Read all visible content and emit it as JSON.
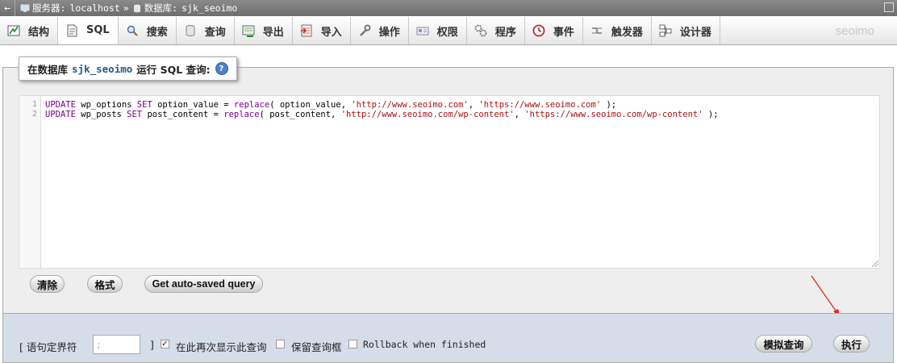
{
  "breadcrumb": {
    "back": "←",
    "server_label": "服务器:",
    "server_value": "localhost",
    "separator": "»",
    "db_label": "数据库:",
    "db_value": "sjk_seoimo"
  },
  "tabs": [
    {
      "label": "结构",
      "icon": "structure-icon"
    },
    {
      "label": "SQL",
      "icon": "sql-icon"
    },
    {
      "label": "搜索",
      "icon": "search-icon"
    },
    {
      "label": "查询",
      "icon": "query-icon"
    },
    {
      "label": "导出",
      "icon": "export-icon"
    },
    {
      "label": "导入",
      "icon": "import-icon"
    },
    {
      "label": "操作",
      "icon": "wrench-icon"
    },
    {
      "label": "权限",
      "icon": "privileges-icon"
    },
    {
      "label": "程序",
      "icon": "routines-icon"
    },
    {
      "label": "事件",
      "icon": "events-icon"
    },
    {
      "label": "触发器",
      "icon": "triggers-icon"
    },
    {
      "label": "设计器",
      "icon": "designer-icon"
    }
  ],
  "brand": "seoimo",
  "legend": {
    "prefix": "在数据库",
    "db": "sjk_seoimo",
    "suffix": "运行 SQL 查询:",
    "help": "?"
  },
  "editor": {
    "line_numbers": [
      "1",
      "2"
    ],
    "lines": [
      [
        {
          "t": "kw",
          "v": "UPDATE"
        },
        {
          "t": "p",
          "v": " wp_options "
        },
        {
          "t": "kw",
          "v": "SET"
        },
        {
          "t": "p",
          "v": " option_value = "
        },
        {
          "t": "fn",
          "v": "replace"
        },
        {
          "t": "p",
          "v": "( option_value, "
        },
        {
          "t": "str",
          "v": "'http://www.seoimo.com'"
        },
        {
          "t": "p",
          "v": ", "
        },
        {
          "t": "str",
          "v": "'https://www.seoimo.com'"
        },
        {
          "t": "p",
          "v": " );"
        }
      ],
      [
        {
          "t": "kw",
          "v": "UPDATE"
        },
        {
          "t": "p",
          "v": " wp_posts "
        },
        {
          "t": "kw",
          "v": "SET"
        },
        {
          "t": "p",
          "v": " post_content = "
        },
        {
          "t": "fn",
          "v": "replace"
        },
        {
          "t": "p",
          "v": "( post_content, "
        },
        {
          "t": "str",
          "v": "'http://www.seoimo.com/wp-content'"
        },
        {
          "t": "p",
          "v": ", "
        },
        {
          "t": "str",
          "v": "'https://www.seoimo.com/wp-content'"
        },
        {
          "t": "p",
          "v": " );"
        }
      ]
    ]
  },
  "buttons": {
    "clear": "清除",
    "format": "格式",
    "autosave": "Get auto-saved query",
    "simulate": "模拟查询",
    "go": "执行"
  },
  "bottom": {
    "delimiter_label_open": "[ 语句定界符",
    "delimiter_value": ";",
    "delimiter_label_close": "]",
    "show_again_label": "在此再次显示此查询",
    "show_again_checked": true,
    "retain_box_label": "保留查询框",
    "retain_box_checked": false,
    "rollback_label": "Rollback when finished",
    "rollback_checked": false
  },
  "colors": {
    "arrow": "#e8261b",
    "sql_keyword": "#770088",
    "sql_string": "#aa1111"
  }
}
